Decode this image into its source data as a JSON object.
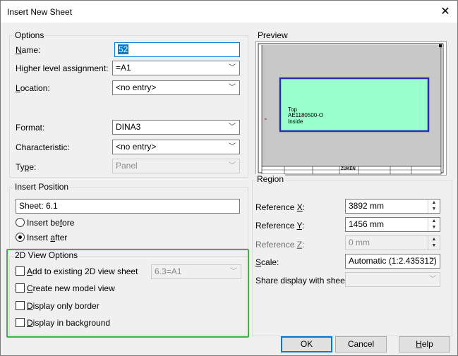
{
  "window": {
    "title": "Insert New Sheet",
    "close_icon": "close-icon"
  },
  "options": {
    "title": "Options",
    "name_label": "Name:",
    "name_value": "52",
    "higher_level_label": "Higher level assignment:",
    "higher_level_value": "=A1",
    "location_label": "Location:",
    "location_value": "<no entry>",
    "format_label": "Format:",
    "format_value": "DINA3",
    "characteristic_label": "Characteristic:",
    "characteristic_value": "<no entry>",
    "type_label": "Type:",
    "type_value": "Panel"
  },
  "insert_position": {
    "title": "Insert Position",
    "sheet_value": "Sheet: 6.1",
    "before_label": "Insert before",
    "after_label": "Insert after",
    "selected": "after"
  },
  "view_options": {
    "title": "2D View Options",
    "add_existing_label": "Add to existing 2D view sheet",
    "add_existing_value": "6.3=A1",
    "create_model_label": "Create new model view",
    "display_border_label": "Display only border",
    "display_background_label": "Display in background"
  },
  "preview": {
    "title": "Preview",
    "box_line1": "Top",
    "box_line2": "AE1180500-O",
    "box_line3": "Inside",
    "titleblock_logo": "ZUKEN",
    "colors": {
      "sheet": "#c8c8c8",
      "box": "#99ffcc",
      "box_border": "#2c2cad"
    }
  },
  "region": {
    "title": "Region",
    "ref_x_label": "Reference X:",
    "ref_x_value": "3892 mm",
    "ref_y_label": "Reference Y:",
    "ref_y_value": "1456 mm",
    "ref_z_label": "Reference Z:",
    "ref_z_value": "0 mm",
    "scale_label": "Scale:",
    "scale_value": "Automatic (1:2.435312)",
    "share_label": "Share display with sheet:",
    "share_value": ""
  },
  "buttons": {
    "ok": "OK",
    "cancel": "Cancel",
    "help": "Help"
  },
  "colors": {
    "accent": "#0078d7",
    "highlight_box": "#3db53d"
  }
}
